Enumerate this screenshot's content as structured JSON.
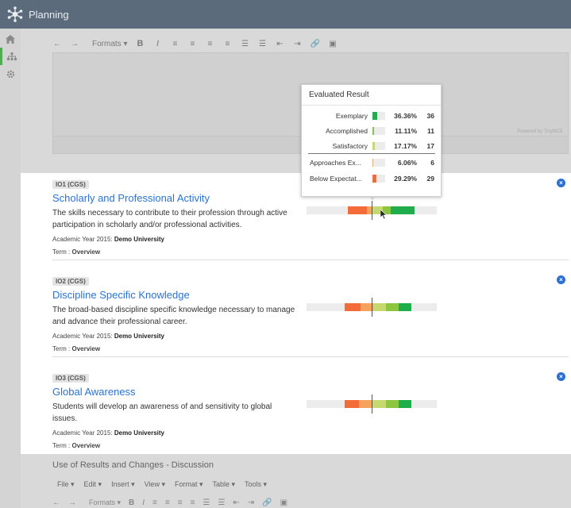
{
  "app": {
    "title": "Planning"
  },
  "editor": {
    "toolbar": {
      "undo": "←",
      "redo": "→",
      "formats": "Formats ▾",
      "bold": "B",
      "italic": "I"
    },
    "powered_by": "Powered by TinyMCE"
  },
  "tooltip": {
    "title": "Evaluated Result",
    "rows": [
      {
        "label": "Exemplary",
        "percent": "36.36%",
        "count": "36",
        "fraction": 0.3636,
        "color": "#1fae4b"
      },
      {
        "label": "Accomplished",
        "percent": "11.11%",
        "count": "11",
        "fraction": 0.1111,
        "color": "#8cc63e"
      },
      {
        "label": "Satisfactory",
        "percent": "17.17%",
        "count": "17",
        "fraction": 0.1717,
        "color": "#c6d96e"
      },
      {
        "label": "Approaches Ex...",
        "percent": "6.06%",
        "count": "6",
        "fraction": 0.0606,
        "color": "#f5a25d"
      },
      {
        "label": "Below Expectat...",
        "percent": "29.29%",
        "count": "29",
        "fraction": 0.2929,
        "color": "#f26b38"
      }
    ]
  },
  "outcomes": [
    {
      "code": "IO1 (CGS)",
      "title": "Scholarly and Professional Activity",
      "description": "The skills necessary to contribute to their profession through active participation in scholarly and/or professional activities.",
      "year_label": "Academic Year 2015:",
      "year_value": "Demo University",
      "term_label": "Term :",
      "term_value": "Overview"
    },
    {
      "code": "IO2 (CGS)",
      "title": "Discipline Specific Knowledge",
      "description": "The broad-based discipline specific knowledge necessary to manage and advance their professional career.",
      "year_label": "Academic Year 2015:",
      "year_value": "Demo University",
      "term_label": "Term :",
      "term_value": "Overview"
    },
    {
      "code": "IO3 (CGS)",
      "title": "Global Awareness",
      "description": "Students will develop an awareness of and sensitivity to global issues.",
      "year_label": "Academic Year 2015:",
      "year_value": "Demo University",
      "term_label": "Term :",
      "term_value": "Overview"
    }
  ],
  "bottom": {
    "section_title": "Use of Results and Changes - Discussion",
    "menu": [
      "File ▾",
      "Edit ▾",
      "Insert ▾",
      "View ▾",
      "Format ▾",
      "Table ▾",
      "Tools ▾"
    ],
    "formats": "Formats ▾",
    "bold": "B",
    "italic": "I"
  },
  "colors": {
    "below": "#f26b38",
    "approaches": "#f5a25d",
    "satisfactory": "#c6d96e",
    "accomplished": "#8cc63e",
    "exemplary": "#1fae4b",
    "link": "#2b73c9",
    "topbar": "#5b6b7c"
  }
}
